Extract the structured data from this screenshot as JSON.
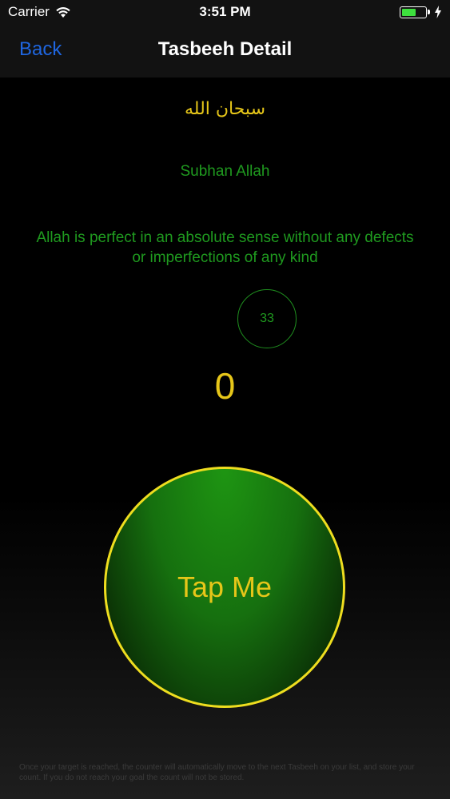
{
  "status_bar": {
    "carrier": "Carrier",
    "time": "3:51 PM",
    "battery_level": 0.6,
    "icons": [
      "wifi-icon",
      "battery-icon",
      "charging-bolt-icon"
    ]
  },
  "nav": {
    "back_label": "Back",
    "title": "Tasbeeh Detail"
  },
  "tasbeeh": {
    "arabic": "سبحان الله",
    "transliteration": "Subhan Allah",
    "meaning": "Allah is perfect in an absolute sense without any defects or imperfections of any kind",
    "target": "33",
    "count": "0"
  },
  "tap_button": {
    "label": "Tap Me"
  },
  "footer": {
    "note": "Once your target is reached, the counter will automatically move to the next Tasbeeh on your list, and store your count. If you do not reach your goal the count will not be stored."
  },
  "colors": {
    "accent_blue": "#1f66e0",
    "gold": "#e6c619",
    "green_text": "#1f9a1f",
    "button_green": "#16700f",
    "button_border": "#eedd1f"
  }
}
